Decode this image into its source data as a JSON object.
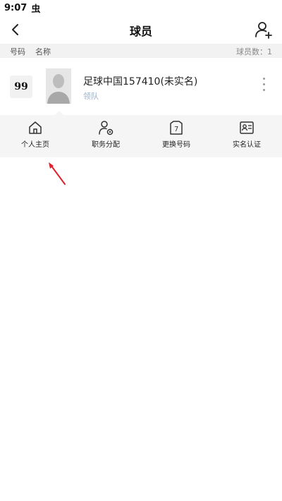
{
  "status_bar": {
    "time": "9:07",
    "notification_glyph": "虫"
  },
  "nav": {
    "title": "球员",
    "back_icon": "chevron-left",
    "add_icon": "add-user"
  },
  "list_header": {
    "number_label": "号码",
    "name_label": "名称",
    "count_label": "球员数：1"
  },
  "player": {
    "jersey_number": "99",
    "name": "足球中国157410(未实名)",
    "role": "领队"
  },
  "actions": [
    {
      "label": "个人主页",
      "icon": "home-icon"
    },
    {
      "label": "职务分配",
      "icon": "user-gear-icon"
    },
    {
      "label": "更换号码",
      "icon": "jersey-icon"
    },
    {
      "label": "实名认证",
      "icon": "id-card-icon"
    }
  ],
  "colors": {
    "header_bg": "#f2f2f2",
    "panel_bg": "#f5f5f5",
    "role_text": "#9bb0c8",
    "arrow": "#e0202a"
  }
}
